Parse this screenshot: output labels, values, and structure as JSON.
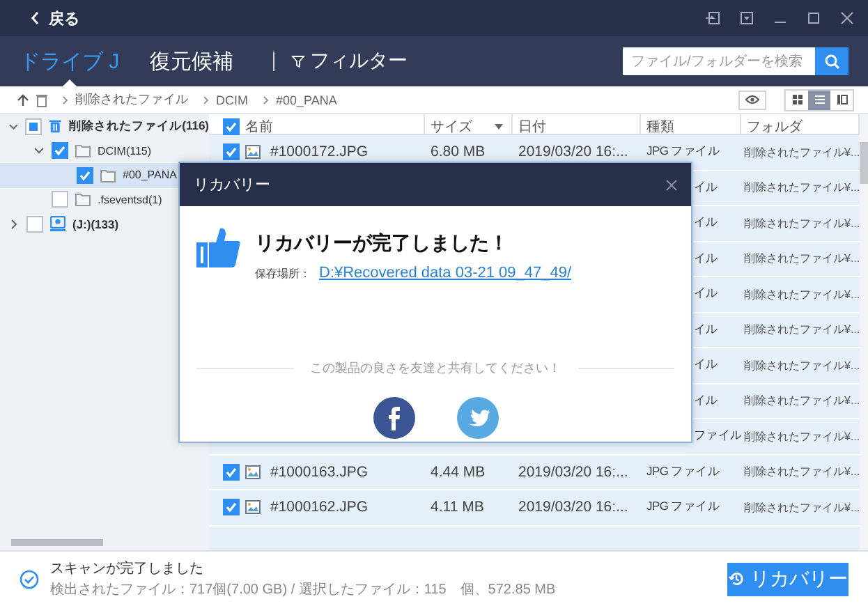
{
  "window": {
    "back_label": "戻る"
  },
  "nav": {
    "tabs": [
      {
        "label": "ドライブ J",
        "selected": true
      },
      {
        "label": "復元候補",
        "selected": false
      }
    ],
    "filter_label": "フィルター",
    "search": {
      "placeholder": "ファイル/フォルダーを検索"
    }
  },
  "breadcrumb": [
    "削除されたファイル",
    "DCIM",
    "#00_PANA"
  ],
  "views": [
    {
      "selected": false
    },
    {
      "selected": true
    },
    {
      "selected": false
    }
  ],
  "tree": [
    {
      "label": "削除されたファイル(116)",
      "kind": "trash",
      "checked": false,
      "partial": true,
      "selected": false,
      "expanded": true,
      "children": [
        {
          "label": "DCIM(115)",
          "kind": "folder",
          "checked": true,
          "partial": false,
          "selected": false,
          "expanded": true,
          "children": [
            {
              "label": "#00_PANA",
              "kind": "folder",
              "checked": true,
              "partial": false,
              "selected": true
            }
          ]
        },
        {
          "label": ".fseventsd(1)",
          "kind": "folder",
          "checked": false,
          "partial": false,
          "selected": false
        }
      ]
    },
    {
      "label": "(J:)(133)",
      "kind": "drive",
      "checked": false,
      "partial": false,
      "selected": false,
      "expanded": false
    }
  ],
  "table": {
    "all_checked": true,
    "columns": [
      {
        "label": "名前",
        "sorted": false
      },
      {
        "label": "サイズ",
        "sorted": true
      },
      {
        "label": "日付",
        "sorted": false
      },
      {
        "label": "種類",
        "sorted": false
      },
      {
        "label": "フォルダ",
        "sorted": false
      }
    ],
    "rows": [
      {
        "kind": "full",
        "checked": true,
        "name": "#1000172.JPG",
        "size": "6.80 MB",
        "date": "2019/03/20 16:...",
        "type": "JPG ファイル",
        "folder": "削除されたファイル¥..."
      },
      {
        "kind": "covered",
        "type": "イル",
        "folder": "削除されたファイル¥..."
      },
      {
        "kind": "covered",
        "type": "イル",
        "folder": "削除されたファイル¥..."
      },
      {
        "kind": "covered",
        "type": "イル",
        "folder": "削除されたファイル¥..."
      },
      {
        "kind": "covered",
        "type": "イル",
        "folder": "削除されたファイル¥..."
      },
      {
        "kind": "covered",
        "type": "イル",
        "folder": "削除されたファイル¥..."
      },
      {
        "kind": "covered",
        "type": "イル",
        "folder": "削除されたファイル¥..."
      },
      {
        "kind": "covered",
        "type": "イル",
        "folder": "削除されたファイル¥..."
      },
      {
        "kind": "covered",
        "type": "ファイル",
        "folder": "削除されたファイル¥..."
      },
      {
        "kind": "full",
        "checked": true,
        "name": "#1000163.JPG",
        "size": "4.44 MB",
        "date": "2019/03/20 16:...",
        "type": "JPG ファイル",
        "folder": "削除されたファイル¥..."
      },
      {
        "kind": "full",
        "checked": true,
        "name": "#1000162.JPG",
        "size": "4.11 MB",
        "date": "2019/03/20 16:...",
        "type": "JPG ファイル",
        "folder": "削除されたファイル¥..."
      }
    ]
  },
  "dialog": {
    "title": "リカバリー",
    "heading": "リカバリーが完了しました！",
    "location_label": "保存場所：",
    "location_link": "D:¥Recovered data 03-21 09_47_49/",
    "share_text": "この製品の良さを友達と共有してください！"
  },
  "status": {
    "title": "スキャンが完了しました",
    "details": "検出されたファイル：717個(7.00 GB) / 選択したファイル：115　個、572.85 MB",
    "button": "リカバリー"
  }
}
